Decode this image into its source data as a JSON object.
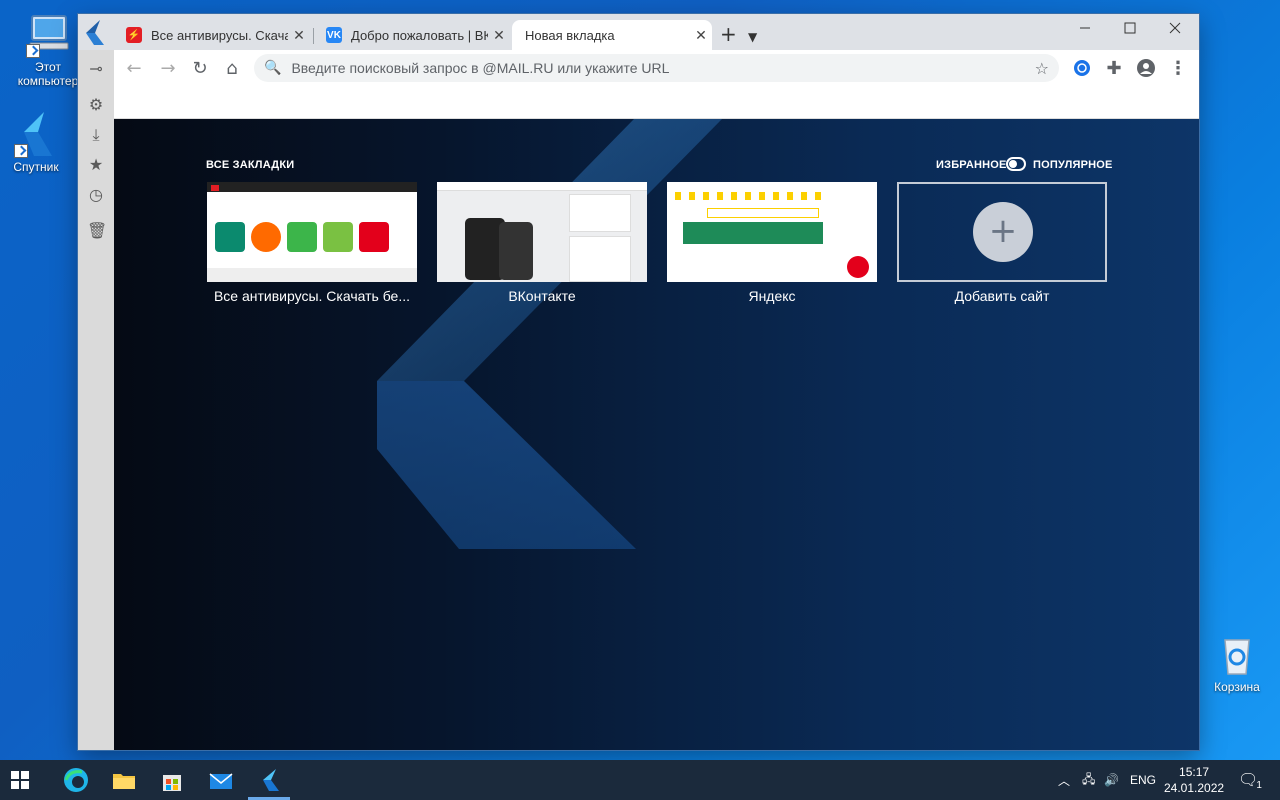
{
  "desktop": {
    "icons": [
      {
        "label": "Этот компьютер"
      },
      {
        "label": "Спутник"
      },
      {
        "label": "Корзина"
      }
    ]
  },
  "browser": {
    "tabs": [
      {
        "title": "Все антивирусы. Скачать",
        "favicon": "antivirus-favicon",
        "color": "#e31e24"
      },
      {
        "title": "Добро пожаловать | ВКо",
        "favicon": "vk-favicon",
        "color": "#2787f5"
      },
      {
        "title": "Новая вкладка",
        "active": true
      }
    ],
    "omnibox_placeholder": "Введите поисковый запрос в @MAIL.RU или укажите URL",
    "newtab": {
      "all_bookmarks": "ВСЕ ЗАКЛАДКИ",
      "favorites": "ИЗБРАННОЕ",
      "popular": "ПОПУЛЯРНОЕ",
      "tiles": [
        {
          "label": "Все антивирусы. Скачать бе..."
        },
        {
          "label": "ВКонтакте"
        },
        {
          "label": "Яндекс"
        },
        {
          "label": "Добавить сайт"
        }
      ]
    }
  },
  "taskbar": {
    "language": "ENG",
    "time": "15:17",
    "date": "24.01.2022",
    "notification_count": "1"
  }
}
